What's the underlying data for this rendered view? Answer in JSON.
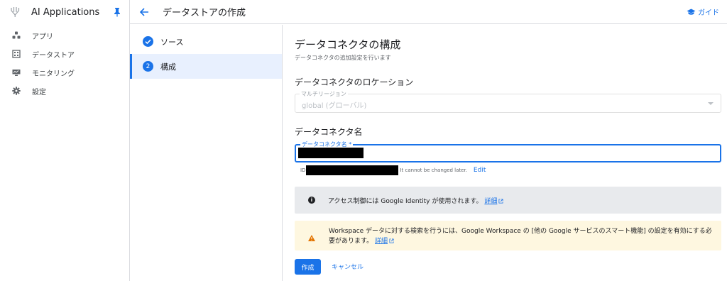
{
  "app": {
    "name": "AI Applications",
    "nav": [
      {
        "label": "アプリ",
        "icon": "apps-icon"
      },
      {
        "label": "データストア",
        "icon": "datastore-icon"
      },
      {
        "label": "モニタリング",
        "icon": "monitoring-icon"
      },
      {
        "label": "設定",
        "icon": "gear-icon"
      }
    ]
  },
  "topbar": {
    "title": "データストアの作成",
    "guide_label": "ガイド"
  },
  "stepper": {
    "steps": [
      {
        "label": "ソース",
        "state": "completed"
      },
      {
        "label": "構成",
        "number": "2",
        "state": "active"
      }
    ]
  },
  "main": {
    "title": "データコネクタの構成",
    "subtitle": "データコネクタの追加設定を行います",
    "location_heading": "データコネクタのロケーション",
    "location_field": {
      "label": "マルチリージョン",
      "value": "global (グローバル)"
    },
    "name_heading": "データコネクタ名",
    "name_field": {
      "label": "データコネクタ名 *"
    },
    "id_row": {
      "prefix": "ID",
      "note": "It cannot be changed later.",
      "edit_label": "Edit"
    },
    "info": {
      "text": "アクセス制御には Google Identity が使用されます。",
      "link": "詳細"
    },
    "warning": {
      "text": "Workspace データに対する検索を行うには、Google Workspace の [他の Google サービスのスマート機能] の設定を有効にする必要があります。",
      "link": "詳細"
    },
    "create_label": "作成",
    "cancel_label": "キャンセル"
  },
  "colors": {
    "accent": "#1a73e8",
    "info_bg": "#e8eaed",
    "warning_bg": "#fef7e0",
    "warning_icon": "#e37400"
  }
}
